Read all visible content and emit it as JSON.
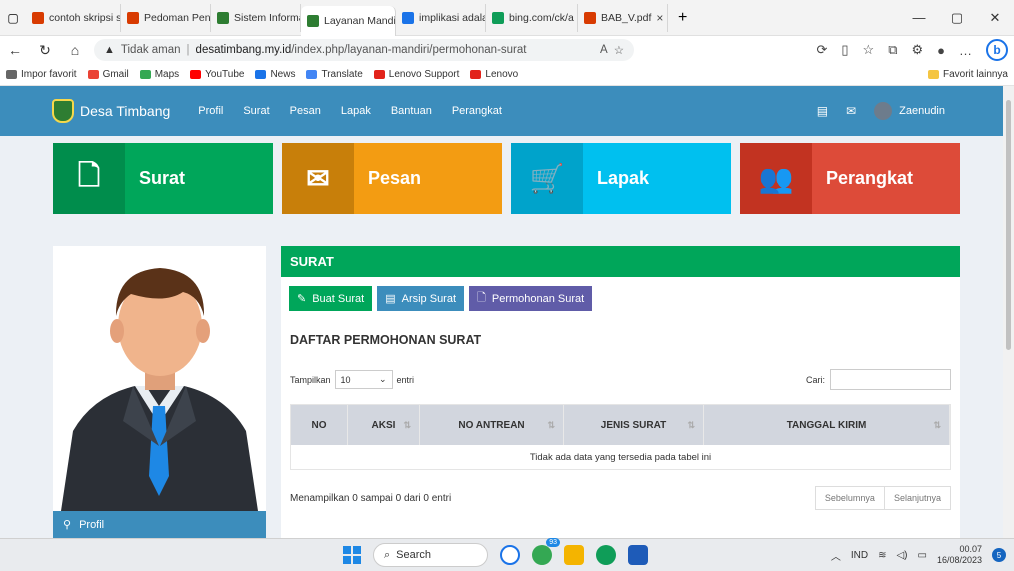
{
  "browser": {
    "tabs": [
      {
        "label": "contoh skripsi s",
        "color": "#d83b01"
      },
      {
        "label": "Pedoman Penu",
        "color": "#d83b01"
      },
      {
        "label": "Sistem Informa",
        "color": "#2e7d32"
      },
      {
        "label": "Layanan Mandi",
        "color": "#2e7d32"
      },
      {
        "label": "implikasi adalal",
        "color": "#1a73e8"
      },
      {
        "label": "bing.com/ck/a",
        "color": "#0f9d58"
      },
      {
        "label": "BAB_V.pdf",
        "color": "#d83b01"
      }
    ],
    "security_label": "Tidak aman",
    "url_host": "desatimbang.my.id",
    "url_path": "/index.php/layanan-mandiri/permohonan-surat",
    "favorites": [
      {
        "label": "Impor favorit",
        "color": "#666666"
      },
      {
        "label": "Gmail",
        "color": "#ea4335"
      },
      {
        "label": "Maps",
        "color": "#34a853"
      },
      {
        "label": "YouTube",
        "color": "#ff0000"
      },
      {
        "label": "News",
        "color": "#1a73e8"
      },
      {
        "label": "Translate",
        "color": "#4285f4"
      },
      {
        "label": "Lenovo Support",
        "color": "#e2231a"
      },
      {
        "label": "Lenovo",
        "color": "#e2231a"
      }
    ],
    "favorites_other": "Favorit lainnya"
  },
  "site": {
    "brand": "Desa Timbang",
    "nav": [
      "Profil",
      "Surat",
      "Pesan",
      "Lapak",
      "Bantuan",
      "Perangkat"
    ],
    "user": "Zaenudin",
    "tiles": [
      {
        "label": "Surat",
        "icon": "word-doc-icon",
        "bg": "#00a65a",
        "icbg": "#008d4c"
      },
      {
        "label": "Pesan",
        "icon": "envelope-icon",
        "bg": "#f39c12",
        "icbg": "#c87f0a"
      },
      {
        "label": "Lapak",
        "icon": "cart-icon",
        "bg": "#00c0ef",
        "icbg": "#00a3cb"
      },
      {
        "label": "Perangkat",
        "icon": "users-icon",
        "bg": "#dd4b39",
        "icbg": "#c23321"
      }
    ],
    "profile_button": "Profil"
  },
  "panel": {
    "header": "SURAT",
    "buttons": [
      {
        "label": "Buat Surat",
        "color": "#00a65a"
      },
      {
        "label": "Arsip Surat",
        "color": "#3c8dbc"
      },
      {
        "label": "Permohonan Surat",
        "color": "#605ca8"
      }
    ],
    "title": "DAFTAR PERMOHONAN SURAT",
    "show_label": "Tampilkan",
    "show_value": "10",
    "entries_label": "entri",
    "search_label": "Cari:",
    "columns": [
      "NO",
      "AKSI",
      "NO ANTREAN",
      "JENIS SURAT",
      "TANGGAL KIRIM"
    ],
    "empty_text": "Tidak ada data yang tersedia pada tabel ini",
    "info_text": "Menampilkan 0 sampai 0 dari 0 entri",
    "prev": "Sebelumnya",
    "next": "Selanjutnya"
  },
  "taskbar": {
    "search": "Search",
    "badge": "93",
    "lang": "IND",
    "time": "00.07",
    "date": "16/08/2023",
    "notif": "5"
  }
}
